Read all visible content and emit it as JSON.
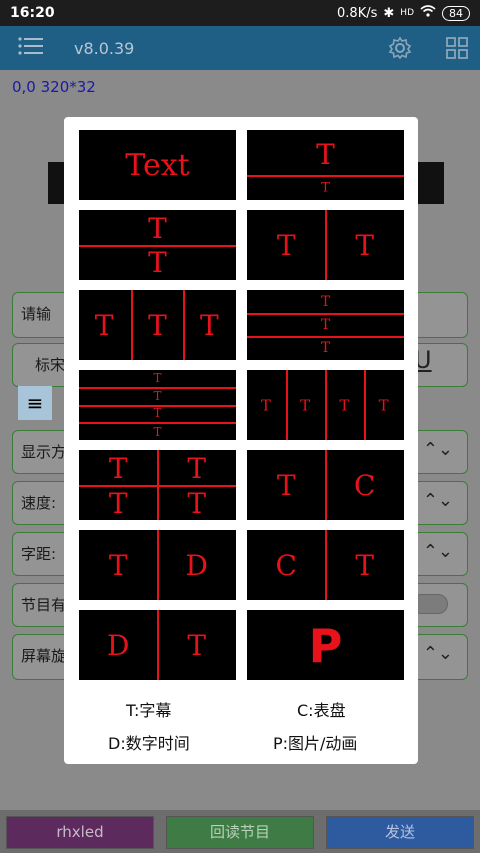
{
  "status_bar": {
    "time": "16:20",
    "speed": "0.8K/s",
    "bluetooth": "✱",
    "signal": "HD",
    "battery": "84"
  },
  "app_bar": {
    "title": "v8.0.39"
  },
  "coords": "0,0 320*32",
  "rows": [
    {
      "label": "请输"
    },
    {
      "label": "标宋"
    },
    {
      "label": "显示方"
    },
    {
      "label": "速度:"
    },
    {
      "label": "字距:"
    },
    {
      "label": "节目有"
    },
    {
      "label": "屏幕旋"
    }
  ],
  "underline_char": "U",
  "bottom": {
    "rhxled": "rhxled",
    "read_back": "回读节目",
    "send": "发送"
  },
  "tiles": {
    "text": "Text",
    "t": "T",
    "c": "C",
    "d": "D",
    "p": "P"
  },
  "legend": {
    "t": "T:字幕",
    "c": "C:表盘",
    "d": "D:数字时间",
    "p": "P:图片/动画"
  },
  "colors": {
    "accent_red": "#e8121a",
    "app_bar": "#1f5f86"
  }
}
